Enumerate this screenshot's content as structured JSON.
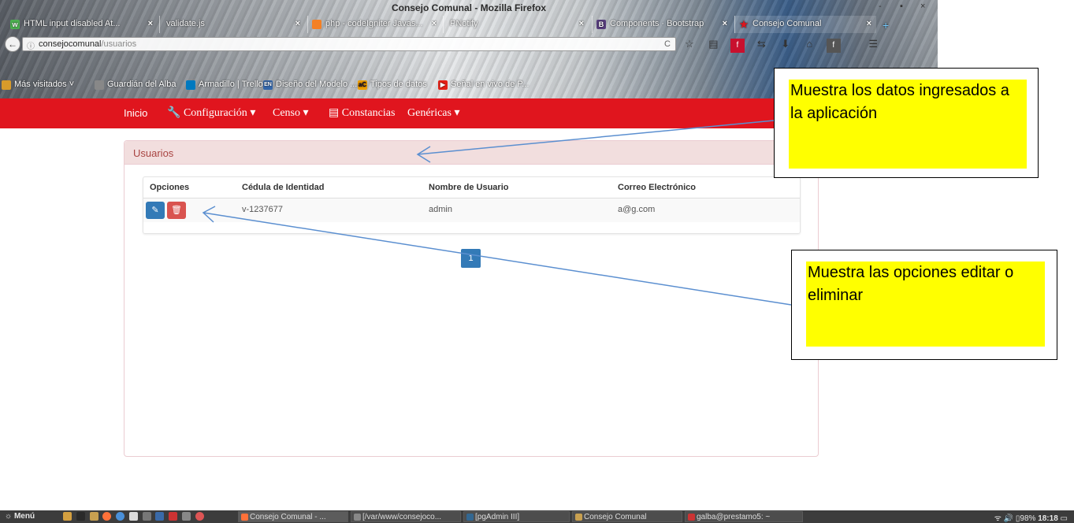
{
  "window": {
    "title": "Consejo Comunal - Mozilla Firefox",
    "controls": [
      "-",
      "▪",
      "×"
    ]
  },
  "tabs": [
    {
      "label": "HTML input disabled At...",
      "icon": "w3-favicon",
      "color": "#4caf50"
    },
    {
      "label": "validate.js",
      "icon": "page-favicon",
      "color": "#999999"
    },
    {
      "label": "php - codeIgniter Javas...",
      "icon": "stackoverflow-favicon",
      "color": "#f48024"
    },
    {
      "label": "PNotify",
      "icon": "page-favicon",
      "color": "#999999"
    },
    {
      "label": "Components · Bootstrap",
      "icon": "bootstrap-favicon",
      "color": "#563d7c"
    },
    {
      "label": "Consejo Comunal",
      "icon": "star-favicon",
      "color": "#e0151e"
    }
  ],
  "urlbar": {
    "host": "consejocomunal",
    "path": "/usuarios"
  },
  "bookmarks": [
    {
      "label": "Más visitados",
      "color": "#d89b2b"
    },
    {
      "label": "Guardián del Alba",
      "color": "#888888"
    },
    {
      "label": "Armadillo | Trello",
      "color": "#0079bf"
    },
    {
      "label": "Diseño del Modelo ...",
      "color": "#3366aa"
    },
    {
      "label": "Tipos de datos",
      "color": "#f0a000"
    },
    {
      "label": "Señal en vivo de P...",
      "color": "#e62117"
    }
  ],
  "app_nav": {
    "home": "Inicio",
    "configuracion": "Configuración",
    "censo": "Censo",
    "constancias": "Constancias",
    "genericas": "Genéricas"
  },
  "panel": {
    "title": "Usuarios",
    "columns": [
      "Opciones",
      "Cédula de Identidad",
      "Nombre de Usuario",
      "Correo Electrónico"
    ],
    "rows": [
      {
        "cedula": "v-1237677",
        "usuario": "admin",
        "correo": "a@g.com"
      }
    ],
    "page": "1"
  },
  "callouts": {
    "data": "Muestra los datos ingresados a la aplicación",
    "options": "Muestra las opciones editar o eliminar"
  },
  "taskbar": {
    "menu": "Menú",
    "tasks": [
      {
        "label": "Consejo Comunal - ...",
        "color": "#ff7139"
      },
      {
        "label": "[/var/www/consejoco...",
        "color": "#888888"
      },
      {
        "label": "[pgAdmin III]",
        "color": "#336791"
      },
      {
        "label": "Consejo Comunal",
        "color": "#c8a050"
      },
      {
        "label": "galba@prestamo5: ~",
        "color": "#cc3333"
      }
    ],
    "battery": "98%",
    "clock": "18:18"
  }
}
